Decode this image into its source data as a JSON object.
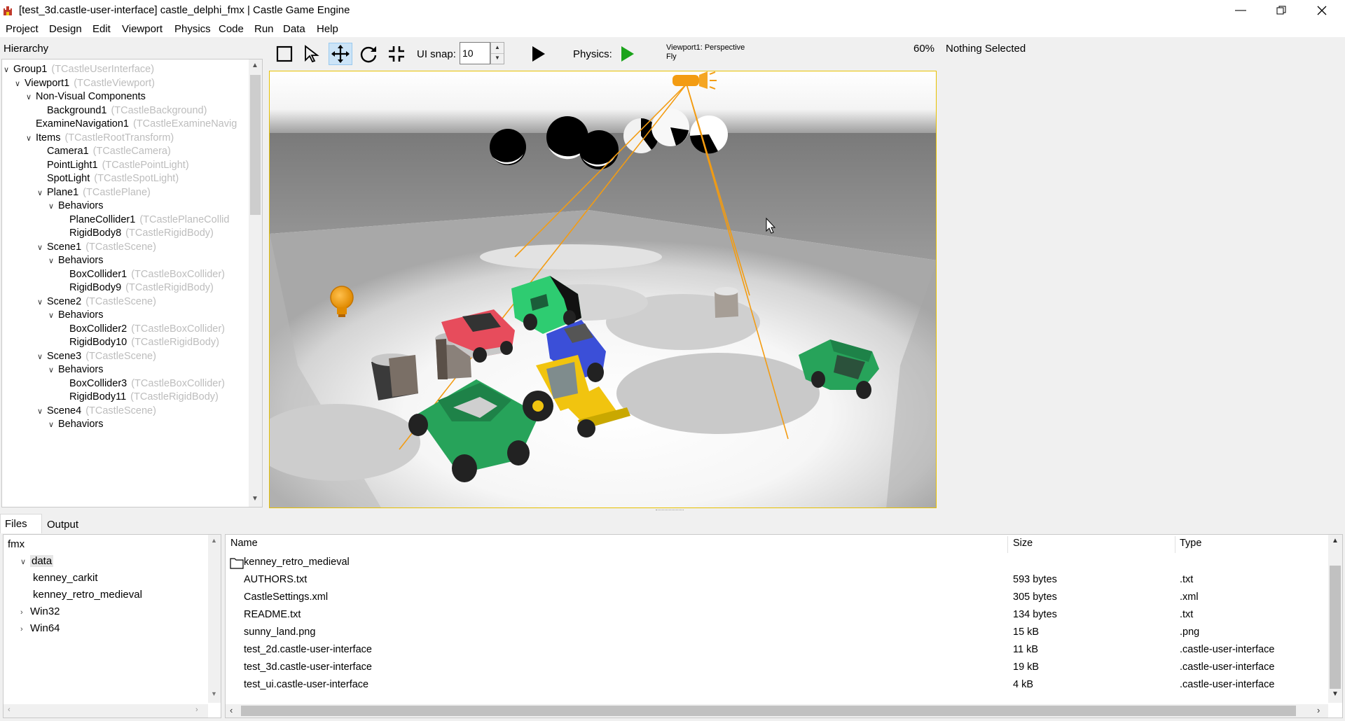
{
  "window": {
    "title": "[test_3d.castle-user-interface] castle_delphi_fmx | Castle Game Engine"
  },
  "menu": [
    "Project",
    "Design",
    "Edit",
    "Viewport",
    "Physics",
    "Code",
    "Run",
    "Data",
    "Help"
  ],
  "hierarchy": {
    "label": "Hierarchy",
    "nodes": [
      {
        "name": "Group1",
        "cls": "(TCastleUserInterface)",
        "depth": 0,
        "expanded": true
      },
      {
        "name": "Viewport1",
        "cls": "(TCastleViewport)",
        "depth": 1,
        "expanded": true
      },
      {
        "name": "Non-Visual Components",
        "cls": "",
        "depth": 2,
        "expanded": true
      },
      {
        "name": "Background1",
        "cls": "(TCastleBackground)",
        "depth": 3
      },
      {
        "name": "ExamineNavigation1",
        "cls": "(TCastleExamineNavig",
        "depth": 2
      },
      {
        "name": "Items",
        "cls": "(TCastleRootTransform)",
        "depth": 2,
        "expanded": true
      },
      {
        "name": "Camera1",
        "cls": "(TCastleCamera)",
        "depth": 3
      },
      {
        "name": "PointLight1",
        "cls": "(TCastlePointLight)",
        "depth": 3
      },
      {
        "name": "SpotLight",
        "cls": "(TCastleSpotLight)",
        "depth": 3
      },
      {
        "name": "Plane1",
        "cls": "(TCastlePlane)",
        "depth": 3,
        "expanded": true
      },
      {
        "name": "Behaviors",
        "cls": "",
        "depth": 4,
        "expanded": true
      },
      {
        "name": "PlaneCollider1",
        "cls": "(TCastlePlaneCollid",
        "depth": 5
      },
      {
        "name": "RigidBody8",
        "cls": "(TCastleRigidBody)",
        "depth": 5
      },
      {
        "name": "Scene1",
        "cls": "(TCastleScene)",
        "depth": 3,
        "expanded": true
      },
      {
        "name": "Behaviors",
        "cls": "",
        "depth": 4,
        "expanded": true
      },
      {
        "name": "BoxCollider1",
        "cls": "(TCastleBoxCollider)",
        "depth": 5
      },
      {
        "name": "RigidBody9",
        "cls": "(TCastleRigidBody)",
        "depth": 5
      },
      {
        "name": "Scene2",
        "cls": "(TCastleScene)",
        "depth": 3,
        "expanded": true
      },
      {
        "name": "Behaviors",
        "cls": "",
        "depth": 4,
        "expanded": true
      },
      {
        "name": "BoxCollider2",
        "cls": "(TCastleBoxCollider)",
        "depth": 5
      },
      {
        "name": "RigidBody10",
        "cls": "(TCastleRigidBody)",
        "depth": 5
      },
      {
        "name": "Scene3",
        "cls": "(TCastleScene)",
        "depth": 3,
        "expanded": true
      },
      {
        "name": "Behaviors",
        "cls": "",
        "depth": 4,
        "expanded": true
      },
      {
        "name": "BoxCollider3",
        "cls": "(TCastleBoxCollider)",
        "depth": 5
      },
      {
        "name": "RigidBody11",
        "cls": "(TCastleRigidBody)",
        "depth": 5
      },
      {
        "name": "Scene4",
        "cls": "(TCastleScene)",
        "depth": 3,
        "expanded": true
      },
      {
        "name": "Behaviors",
        "cls": "",
        "depth": 4,
        "expanded": true
      }
    ]
  },
  "toolbar": {
    "tools": [
      "select-rect-icon",
      "pointer-icon",
      "move-icon",
      "rotate-icon",
      "scale-icon"
    ],
    "ui_snap_label": "UI snap:",
    "ui_snap_value": "10",
    "physics_label": "Physics:",
    "viewport_info_line1": "Viewport1: Perspective",
    "viewport_info_line2": "Fly",
    "zoom": "60%",
    "selection": "Nothing Selected"
  },
  "bottom": {
    "tabs": [
      "Files",
      "Output"
    ],
    "tree": [
      {
        "name": "fmx",
        "depth": 0
      },
      {
        "name": "data",
        "depth": 1,
        "expanded": true,
        "selected": true
      },
      {
        "name": "kenney_carkit",
        "depth": 2
      },
      {
        "name": "kenney_retro_medieval",
        "depth": 2
      },
      {
        "name": "Win32",
        "depth": 1,
        "expandable": true
      },
      {
        "name": "Win64",
        "depth": 1,
        "expandable": true
      }
    ],
    "columns": [
      "Name",
      "Size",
      "Type"
    ],
    "files": [
      {
        "name": "kenney_retro_medieval",
        "size": "",
        "type": "",
        "folder": true
      },
      {
        "name": "AUTHORS.txt",
        "size": "593 bytes",
        "type": ".txt"
      },
      {
        "name": "CastleSettings.xml",
        "size": "305 bytes",
        "type": ".xml"
      },
      {
        "name": "README.txt",
        "size": "134 bytes",
        "type": ".txt"
      },
      {
        "name": "sunny_land.png",
        "size": "15 kB",
        "type": ".png"
      },
      {
        "name": "test_2d.castle-user-interface",
        "size": "11 kB",
        "type": ".castle-user-interface"
      },
      {
        "name": "test_3d.castle-user-interface",
        "size": "19 kB",
        "type": ".castle-user-interface"
      },
      {
        "name": "test_ui.castle-user-interface",
        "size": "4 kB",
        "type": ".castle-user-interface"
      }
    ]
  },
  "colors": {
    "accent_light": "#f39c12",
    "play_green": "#1aa31a",
    "active_tool": "#cce4f7"
  }
}
